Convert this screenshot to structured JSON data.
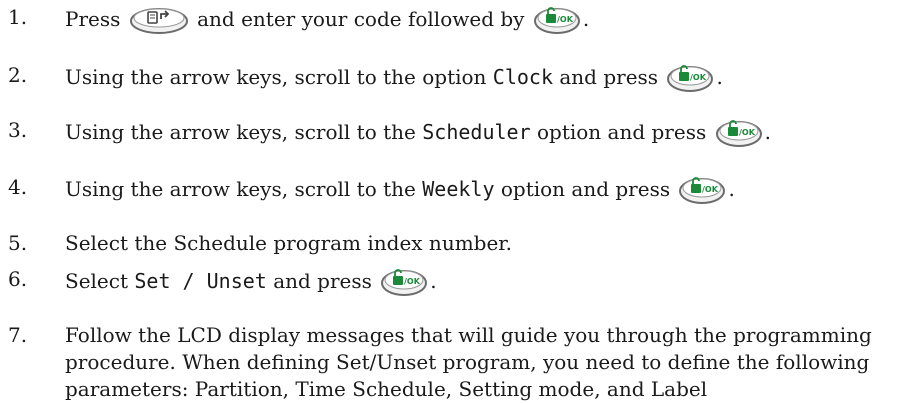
{
  "steps": [
    {
      "number": "1.",
      "parts": {
        "a": "Press",
        "b": "and enter your code followed by",
        "end": "."
      }
    },
    {
      "number": "2.",
      "parts": {
        "a": "Using the arrow keys, scroll to the option",
        "code": "Clock",
        "b": "and press",
        "end": "."
      }
    },
    {
      "number": "3.",
      "parts": {
        "a": "Using the arrow keys, scroll to the",
        "code": "Scheduler",
        "b": "option and press",
        "end": "."
      }
    },
    {
      "number": "4.",
      "parts": {
        "a": "Using the arrow keys, scroll to the",
        "code": "Weekly",
        "b": "option and press",
        "end": "."
      }
    },
    {
      "number": "5.",
      "text": "Select the Schedule program index number."
    },
    {
      "number": "6.",
      "parts": {
        "a": "Select",
        "code": "Set / Unset",
        "b": "and press",
        "end": "."
      }
    },
    {
      "number": "7.",
      "text": "Follow the LCD display messages that will guide you through the programming procedure. When defining Set/Unset program, you need to define the following parameters: Partition, Time Schedule, Setting mode, and Label"
    }
  ],
  "icons": {
    "menu_key": "menu-back-key-icon",
    "ok_key": "unlock-ok-key-icon",
    "ok_key_label": "/OK",
    "colors": {
      "ok_green": "#1a8a3a",
      "key_outline": "#6b6b6b"
    }
  }
}
